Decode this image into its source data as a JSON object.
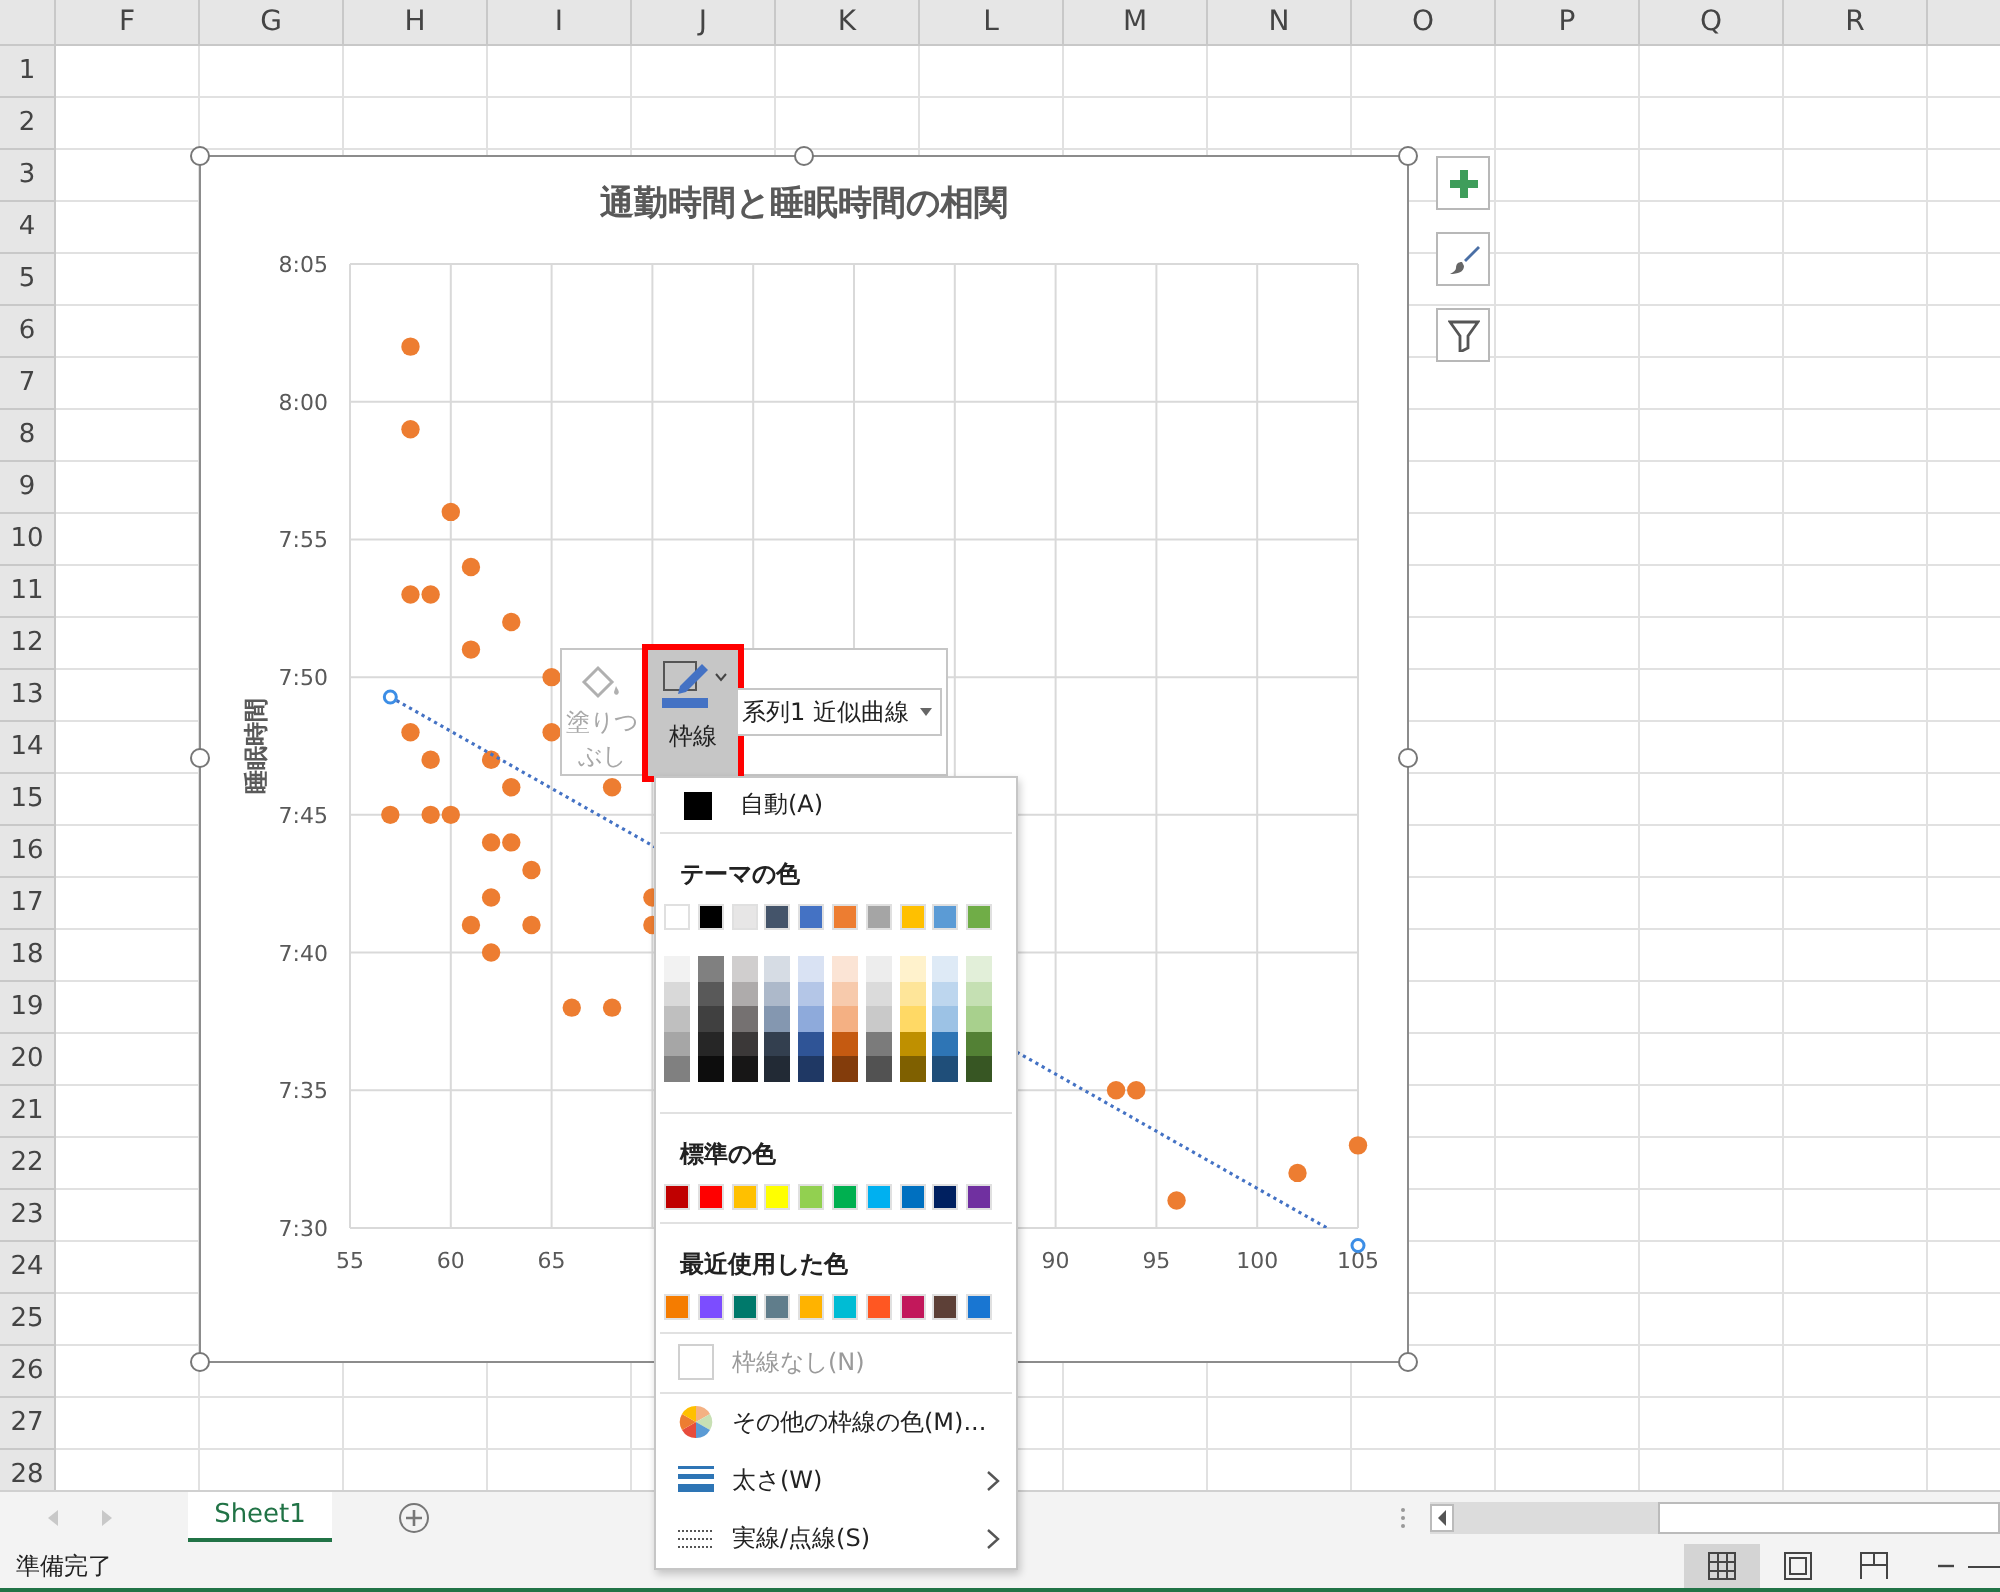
{
  "columns": [
    "F",
    "G",
    "H",
    "I",
    "J",
    "K",
    "L",
    "M",
    "N",
    "O",
    "P",
    "Q",
    "R"
  ],
  "rows": [
    "1",
    "2",
    "3",
    "4",
    "5",
    "6",
    "7",
    "8",
    "9",
    "10",
    "11",
    "12",
    "13",
    "14",
    "15",
    "16",
    "17",
    "18",
    "19",
    "20",
    "21",
    "22",
    "23",
    "24",
    "25",
    "26",
    "27",
    "28"
  ],
  "chart": {
    "selected": true,
    "chart_data": {
      "type": "scatter",
      "grid": true,
      "title": "通勤時間と睡眠時間の相関",
      "ylabel": "睡眠時間",
      "x": [
        58,
        58,
        60,
        58,
        59,
        61,
        63,
        61,
        65,
        65,
        58,
        59,
        62,
        63,
        68,
        57,
        59,
        60,
        62,
        63,
        64,
        62,
        70,
        61,
        64,
        70,
        62,
        66,
        68,
        93,
        94,
        96,
        102,
        105
      ],
      "series": [
        {
          "color": "#ed7d31",
          "values": [
            482,
            479,
            476,
            473,
            473,
            474,
            472,
            471,
            470,
            468,
            468,
            467,
            467,
            466,
            466,
            465,
            465,
            465,
            464,
            464,
            463,
            462,
            462,
            461,
            461,
            461,
            460,
            458,
            458,
            455,
            455,
            451,
            452,
            453
          ]
        }
      ],
      "xlim": [
        55,
        105
      ],
      "ylim": [
        450,
        485
      ],
      "xticks": [
        55,
        60,
        65,
        90,
        95,
        100,
        105
      ],
      "yticks": [
        {
          "value": 450,
          "label": "7:30"
        },
        {
          "value": 455,
          "label": "7:35"
        },
        {
          "value": 460,
          "label": "7:40"
        },
        {
          "value": 465,
          "label": "7:45"
        },
        {
          "value": 470,
          "label": "7:50"
        },
        {
          "value": 475,
          "label": "7:55"
        },
        {
          "value": 480,
          "label": "8:00"
        },
        {
          "value": 485,
          "label": "8:05"
        }
      ]
    }
  },
  "mini_toolbar": {
    "fill": {
      "label": "塗りつぶし",
      "disabled": true
    },
    "outline": {
      "label": "枠線",
      "selected": true
    },
    "element_dropdown": {
      "value": "系列1 近似曲線"
    }
  },
  "color_menu": {
    "automatic": {
      "label": "自動(A)",
      "color": "#000000"
    },
    "theme_heading": "テーマの色",
    "theme_colors": [
      {
        "color": "#ffffff"
      },
      {
        "color": "#000000"
      },
      {
        "color": "#e7e6e6"
      },
      {
        "color": "#44546a"
      },
      {
        "color": "#4472c4"
      },
      {
        "color": "#ed7d31"
      },
      {
        "color": "#a5a5a5"
      },
      {
        "color": "#ffc000"
      },
      {
        "color": "#5b9bd5"
      },
      {
        "color": "#70ad47"
      }
    ],
    "shade_rows": [
      [
        {
          "color": "#f2f2f2"
        },
        {
          "color": "#808080"
        },
        {
          "color": "#d0cece"
        },
        {
          "color": "#d6dce4"
        },
        {
          "color": "#d9e2f3"
        },
        {
          "color": "#fbe4d5"
        },
        {
          "color": "#ededed"
        },
        {
          "color": "#fff2cc"
        },
        {
          "color": "#deeaf6"
        },
        {
          "color": "#e2efd9"
        }
      ],
      [
        {
          "color": "#d9d9d9"
        },
        {
          "color": "#595959"
        },
        {
          "color": "#aeabab"
        },
        {
          "color": "#adb9ca"
        },
        {
          "color": "#b4c6e7"
        },
        {
          "color": "#f7caac"
        },
        {
          "color": "#dbdbdb"
        },
        {
          "color": "#fee599"
        },
        {
          "color": "#bdd6ee"
        },
        {
          "color": "#c5e0b3"
        }
      ],
      [
        {
          "color": "#bfbfbf"
        },
        {
          "color": "#404040"
        },
        {
          "color": "#757171"
        },
        {
          "color": "#8497b0"
        },
        {
          "color": "#8eaadb"
        },
        {
          "color": "#f4b083"
        },
        {
          "color": "#c9c9c9"
        },
        {
          "color": "#ffd965"
        },
        {
          "color": "#9cc2e5"
        },
        {
          "color": "#a8d08d"
        }
      ],
      [
        {
          "color": "#a6a6a6"
        },
        {
          "color": "#262626"
        },
        {
          "color": "#3b3838"
        },
        {
          "color": "#333f4f"
        },
        {
          "color": "#2f5496"
        },
        {
          "color": "#c55a11"
        },
        {
          "color": "#7b7b7b"
        },
        {
          "color": "#bf9000"
        },
        {
          "color": "#2e75b5"
        },
        {
          "color": "#538135"
        }
      ],
      [
        {
          "color": "#808080"
        },
        {
          "color": "#0d0d0d"
        },
        {
          "color": "#171616"
        },
        {
          "color": "#222a35"
        },
        {
          "color": "#1f3864"
        },
        {
          "color": "#833c0b"
        },
        {
          "color": "#525252"
        },
        {
          "color": "#7f6000"
        },
        {
          "color": "#1f4e79"
        },
        {
          "color": "#375623"
        }
      ]
    ],
    "standard_heading": "標準の色",
    "standard_colors": [
      {
        "color": "#c00000"
      },
      {
        "color": "#ff0000"
      },
      {
        "color": "#ffc000"
      },
      {
        "color": "#ffff00"
      },
      {
        "color": "#92d050"
      },
      {
        "color": "#00b050"
      },
      {
        "color": "#00b0f0"
      },
      {
        "color": "#0070c0"
      },
      {
        "color": "#002060"
      },
      {
        "color": "#7030a0"
      }
    ],
    "recent_heading": "最近使用した色",
    "recent_colors": [
      {
        "color": "#f57c00"
      },
      {
        "color": "#7c4dff"
      },
      {
        "color": "#00796b"
      },
      {
        "color": "#607d8b"
      },
      {
        "color": "#ffb300"
      },
      {
        "color": "#00bcd4"
      },
      {
        "color": "#ff5722"
      },
      {
        "color": "#c2185b"
      },
      {
        "color": "#5d4037"
      },
      {
        "color": "#1976d2"
      }
    ],
    "items": [
      {
        "kind": "no-line",
        "label": "枠線なし(N)",
        "disabled": true
      },
      {
        "kind": "more-colors",
        "label": "その他の枠線の色(M)...",
        "disabled": false
      },
      {
        "kind": "weight",
        "label": "太さ(W)",
        "disabled": false
      },
      {
        "kind": "dash",
        "label": "実線/点線(S)",
        "disabled": false
      }
    ]
  },
  "sheet_tabs": [
    {
      "label": "Sheet1",
      "selected": true
    }
  ],
  "status_bar": {
    "text": "準備完了"
  },
  "view_buttons": [
    {
      "kind": "normal",
      "selected": true
    },
    {
      "kind": "page-layout",
      "selected": false
    },
    {
      "kind": "page-break",
      "selected": false
    }
  ]
}
